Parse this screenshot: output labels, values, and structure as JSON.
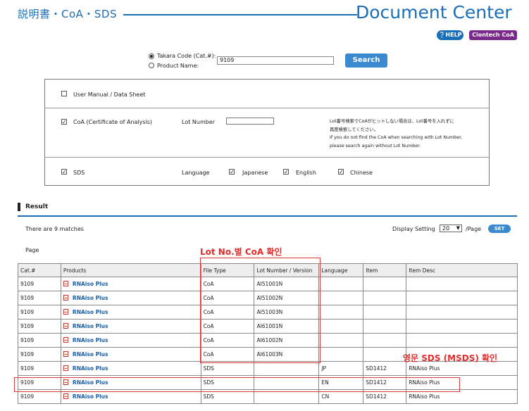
{
  "header": {
    "jp_title": "説明書・CoA・SDS",
    "title": "Document Center",
    "help_label": "HELP",
    "clontech_label": "Clontech CoA"
  },
  "search": {
    "radio_code_label": "Takara Code (Cat.#):",
    "radio_name_label": "Product Name:",
    "query_value": "9109",
    "search_label": "Search"
  },
  "options": {
    "manual_label": "User Manual / Data Sheet",
    "coa_label": "CoA (Certificate of Analysis)",
    "lot_label": "Lot Number",
    "note_lines": [
      "Lot番号検索でCoAがヒットしない場合は、Lot番号を入れずに",
      "再度検索してください。",
      "If you do not find the CoA when searching with Lot Number,",
      "please search again without Lot Number."
    ],
    "sds_label": "SDS",
    "language_label": "Language",
    "lang_japanese": "Japanese",
    "lang_english": "English",
    "lang_chinese": "Chinese"
  },
  "result": {
    "title": "Result",
    "matches_text": "There are 9 matches",
    "display_setting_label": "Display Setting",
    "per_page_value": "20",
    "per_page_suffix": "/Page",
    "set_label": "SET",
    "page_label": "Page"
  },
  "annotations": {
    "coa_note": "Lot No.별 CoA 확인",
    "sds_note": "영문 SDS (MSDS) 확인"
  },
  "table": {
    "columns": [
      "Cat.#",
      "Products",
      "File Type",
      "Lot Number / Version",
      "Language",
      "Item",
      "Item Desc"
    ],
    "rows": [
      [
        "9109",
        "RNAiso Plus",
        "CoA",
        "AI51001N",
        "",
        "",
        ""
      ],
      [
        "9109",
        "RNAiso Plus",
        "CoA",
        "AI51002N",
        "",
        "",
        ""
      ],
      [
        "9109",
        "RNAiso Plus",
        "CoA",
        "AI51003N",
        "",
        "",
        ""
      ],
      [
        "9109",
        "RNAiso Plus",
        "CoA",
        "AI61001N",
        "",
        "",
        ""
      ],
      [
        "9109",
        "RNAiso Plus",
        "CoA",
        "AI61002N",
        "",
        "",
        ""
      ],
      [
        "9109",
        "RNAiso Plus",
        "CoA",
        "AI61003N",
        "",
        "",
        ""
      ],
      [
        "9109",
        "RNAiso Plus",
        "SDS",
        "",
        "JP",
        "SD1412",
        "RNAiso Plus"
      ],
      [
        "9109",
        "RNAiso Plus",
        "SDS",
        "",
        "EN",
        "SD1412",
        "RNAiso Plus"
      ],
      [
        "9109",
        "RNAiso Plus",
        "SDS",
        "",
        "CN",
        "SD1412",
        "RNAiso Plus"
      ]
    ]
  },
  "colors": {
    "brand_blue": "#1a6fb6",
    "annotation_red": "#e22d2d",
    "clontech_purple": "#7a2a8a"
  }
}
